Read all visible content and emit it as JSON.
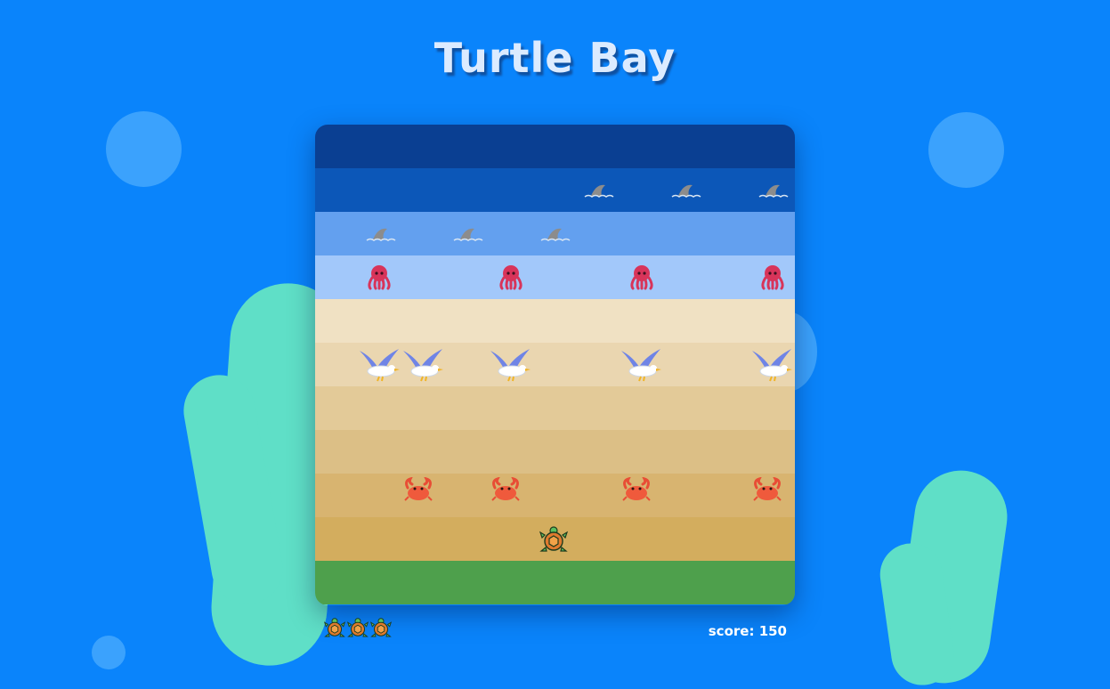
{
  "game": {
    "title": "Turtle Bay",
    "score_label": "score:",
    "score": 150,
    "lives": 3
  },
  "lanes": [
    {
      "kind": "deep-water",
      "color": "#0a3f92"
    },
    {
      "kind": "water",
      "color": "#0c57b8",
      "enemy": "shark-fin"
    },
    {
      "kind": "shallow-water",
      "color": "#63a0ef",
      "enemy": "shark-fin"
    },
    {
      "kind": "shallows",
      "color": "#a2c8fa",
      "enemy": "octopus"
    },
    {
      "kind": "sand",
      "color": "#f0e1c3"
    },
    {
      "kind": "sand",
      "color": "#ead6b0",
      "enemy": "seagull"
    },
    {
      "kind": "sand",
      "color": "#e3ca98"
    },
    {
      "kind": "sand",
      "color": "#dcbf86"
    },
    {
      "kind": "sand",
      "color": "#d8b470",
      "enemy": "crab"
    },
    {
      "kind": "sand",
      "color": "#d3ad5e",
      "player": "turtle"
    },
    {
      "kind": "grass",
      "color": "#4ea04c"
    }
  ],
  "colors": {
    "background": "#0a84fb",
    "title": "#dcebff",
    "seaweed": "#5fdfc7"
  }
}
